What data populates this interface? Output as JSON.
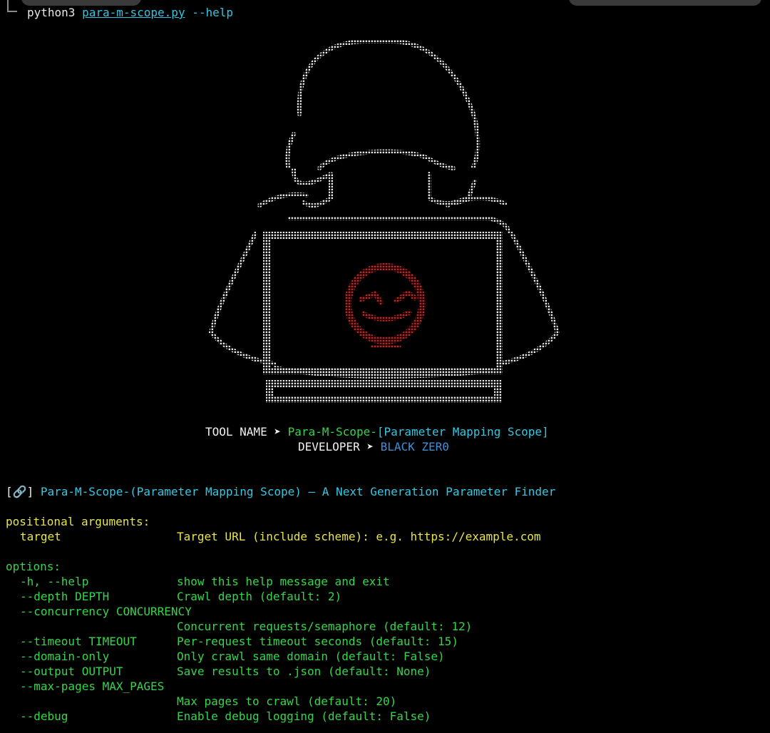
{
  "terminal": {
    "command": {
      "program": "python3",
      "script": "para-m-scope.py",
      "flag": "--help"
    }
  },
  "banner": {
    "tool_name_label": "TOOL NAME ➤",
    "tool_name": "Para-M-Scope-",
    "tool_subtitle": "[Parameter Mapping Scope]",
    "developer_label": "DEVELOPER ➤",
    "developer": "BLACK ZER0"
  },
  "description": {
    "icon": "link-icon",
    "open": "[",
    "close": "]",
    "text": "Para-M-Scope-(Parameter Mapping Scope) — A Next Generation Parameter Finder"
  },
  "help": {
    "positional_heading": "positional arguments:",
    "positional": [
      {
        "name": "target",
        "desc": "Target URL (include scheme): e.g. https://example.com"
      }
    ],
    "options_heading": "options:",
    "options": [
      {
        "name": "-h, --help",
        "desc": "show this help message and exit"
      },
      {
        "name": "--depth DEPTH",
        "desc": "Crawl depth (default: 2)"
      },
      {
        "name": "--concurrency CONCURRENCY",
        "desc": ""
      },
      {
        "name": "",
        "desc": "Concurrent requests/semaphore (default: 12)"
      },
      {
        "name": "--timeout TIMEOUT",
        "desc": "Per-request timeout seconds (default: 15)"
      },
      {
        "name": "--domain-only",
        "desc": "Only crawl same domain (default: False)"
      },
      {
        "name": "--output OUTPUT",
        "desc": "Save results to .json (default: None)"
      },
      {
        "name": "--max-pages MAX_PAGES",
        "desc": ""
      },
      {
        "name": "",
        "desc": "Max pages to crawl (default: 20)"
      },
      {
        "name": "--debug",
        "desc": "Enable debug logging (default: False)"
      }
    ]
  },
  "colors": {
    "background": "#000000",
    "green": "#35d54a",
    "cyan": "#33c7e3",
    "blue": "#3f8fd8",
    "yellow": "#e8e44c",
    "art_white": "#e6e6e6",
    "art_red": "#d11f1f"
  }
}
